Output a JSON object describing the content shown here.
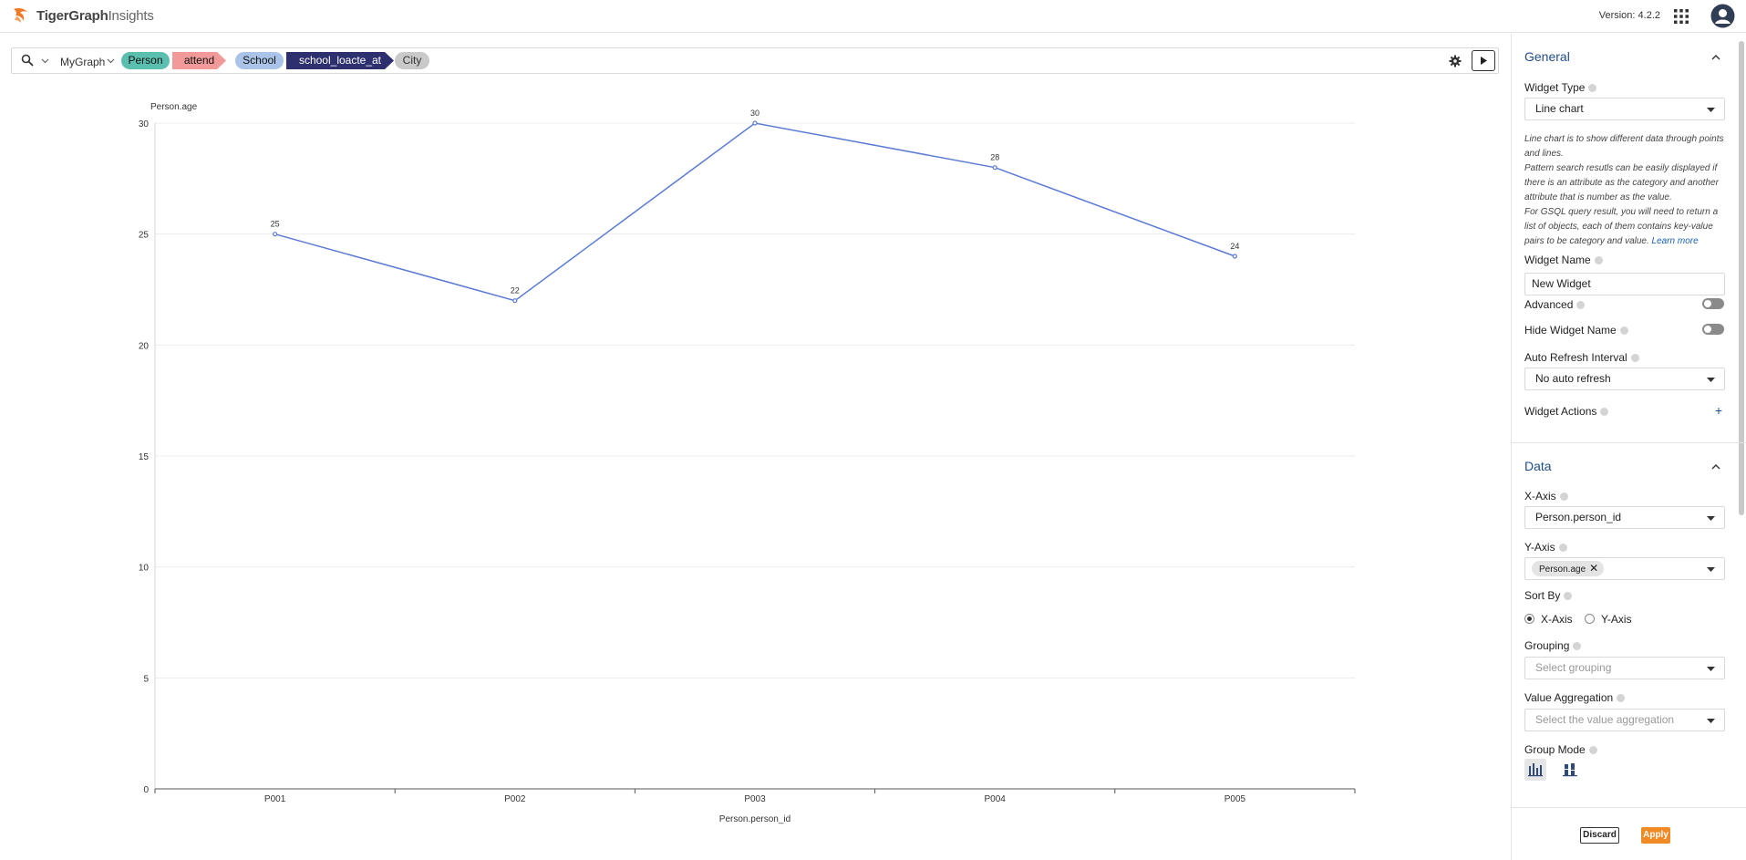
{
  "header": {
    "logo_brand": "TigerGraph",
    "logo_product": "Insights",
    "version": "Version: 4.2.2"
  },
  "query": {
    "graph": "MyGraph",
    "path": [
      {
        "label": "Person",
        "kind": "vertex",
        "color": "#5bbfaf"
      },
      {
        "label": "attend",
        "kind": "edge",
        "color": "#f29a9a"
      },
      {
        "label": "School",
        "kind": "vertex",
        "color": "#a9c4e8"
      },
      {
        "label": "school_loacte_at",
        "kind": "edge",
        "color": "#2d2f6e"
      },
      {
        "label": "City",
        "kind": "vertex",
        "color": "#c9c9c9"
      }
    ]
  },
  "chart_data": {
    "type": "line",
    "categories": [
      "P001",
      "P002",
      "P003",
      "P004",
      "P005"
    ],
    "series": [
      {
        "name": "Person.age",
        "values": [
          25,
          22,
          30,
          28,
          24
        ],
        "color": "#5b7bd5"
      }
    ],
    "xlabel": "Person.person_id",
    "ylabel": "Person.age",
    "ylim": [
      0,
      30
    ],
    "yticks": [
      0,
      5,
      10,
      15,
      20,
      25,
      30
    ],
    "grid": true,
    "data_labels": true
  },
  "panel": {
    "general": {
      "title": "General",
      "widget_type_label": "Widget Type",
      "widget_type_value": "Line chart",
      "description_lines": [
        "Line chart is to show different data through points and lines.",
        "Pattern search resutls can be easily displayed if there is an attribute as the category and another attribute that is number as the value.",
        "For GSQL query result, you will need to return a list of objects, each of them contains key-value pairs to be category and value."
      ],
      "learn_more": "Learn more",
      "widget_name_label": "Widget Name",
      "widget_name_value": "New Widget",
      "advanced_label": "Advanced",
      "hide_name_label": "Hide Widget Name",
      "auto_refresh_label": "Auto Refresh Interval",
      "auto_refresh_value": "No auto refresh",
      "widget_actions_label": "Widget Actions"
    },
    "data": {
      "title": "Data",
      "x_axis_label": "X-Axis",
      "x_axis_value": "Person.person_id",
      "y_axis_label": "Y-Axis",
      "y_axis_tag": "Person.age",
      "sort_by_label": "Sort By",
      "sort_options": [
        "X-Axis",
        "Y-Axis"
      ],
      "sort_selected": "X-Axis",
      "grouping_label": "Grouping",
      "grouping_placeholder": "Select grouping",
      "value_agg_label": "Value Aggregation",
      "value_agg_placeholder": "Select the value aggregation",
      "group_mode_label": "Group Mode"
    },
    "footer": {
      "discard": "Discard",
      "apply": "Apply"
    }
  }
}
